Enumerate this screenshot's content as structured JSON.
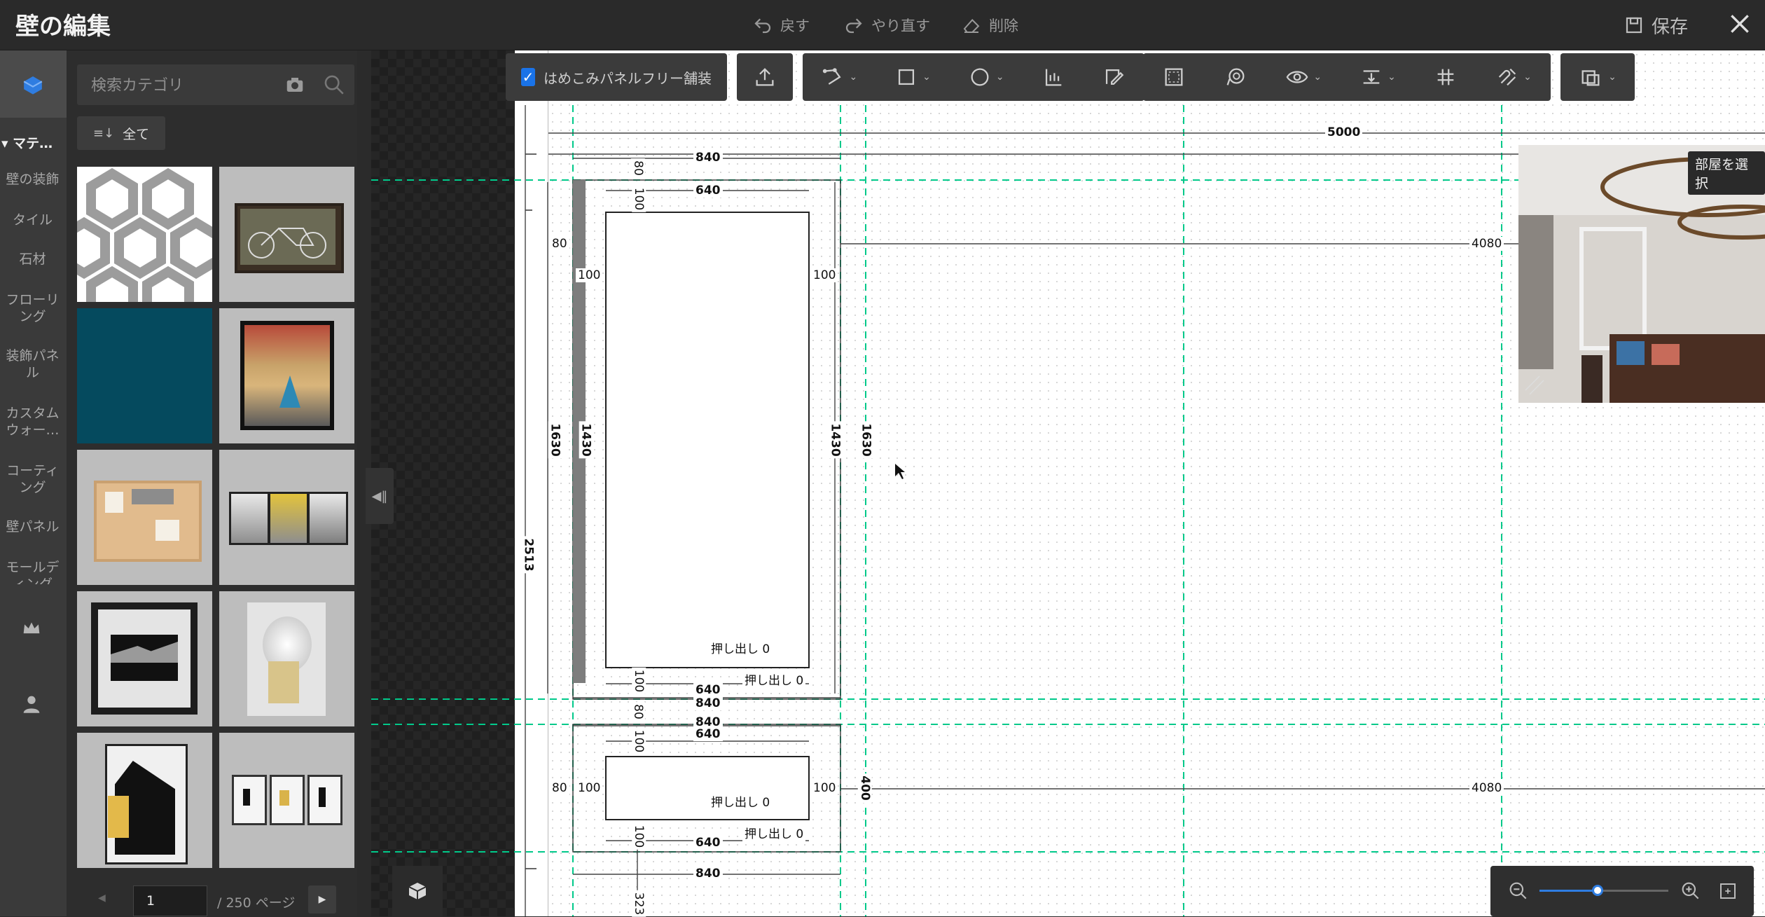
{
  "topbar": {
    "title": "壁の編集",
    "undo": "戻す",
    "redo": "やり直す",
    "delete": "削除",
    "save": "保存"
  },
  "rail": {
    "header": "▾ マテ…",
    "items": [
      "壁の装飾",
      "タイル",
      "石材",
      "フローリング",
      "装飾パネル",
      "カスタムウォー…",
      "コーティング",
      "壁パネル",
      "モールディング"
    ]
  },
  "panel": {
    "search_placeholder": "検索カテゴリ",
    "all_button": "全て",
    "pager": {
      "page": "1",
      "total": "/ 250 ページ"
    }
  },
  "toolbar": {
    "panel_free_label": "はめこみパネルフリー舗装",
    "panel_free_checked": true
  },
  "drawing": {
    "overall_width": "5000",
    "right_dim_top": "4080",
    "right_dim_bottom": "4080",
    "top_width": "840",
    "inner_width": "640",
    "frame_80": "80",
    "margin_100": "100",
    "height_1630": "1630",
    "height_1430": "1430",
    "height_400": "400",
    "left_2513": "2513",
    "bottom_323": "323",
    "extrude_label": "押し出し",
    "extrude_value": "0"
  },
  "preview": {
    "label": "部屋を選択"
  },
  "zoom": {
    "level": 0.45
  },
  "colors": {
    "accent": "#1a73e8",
    "guide": "#00c98a",
    "panel": "#2d2d2d"
  }
}
